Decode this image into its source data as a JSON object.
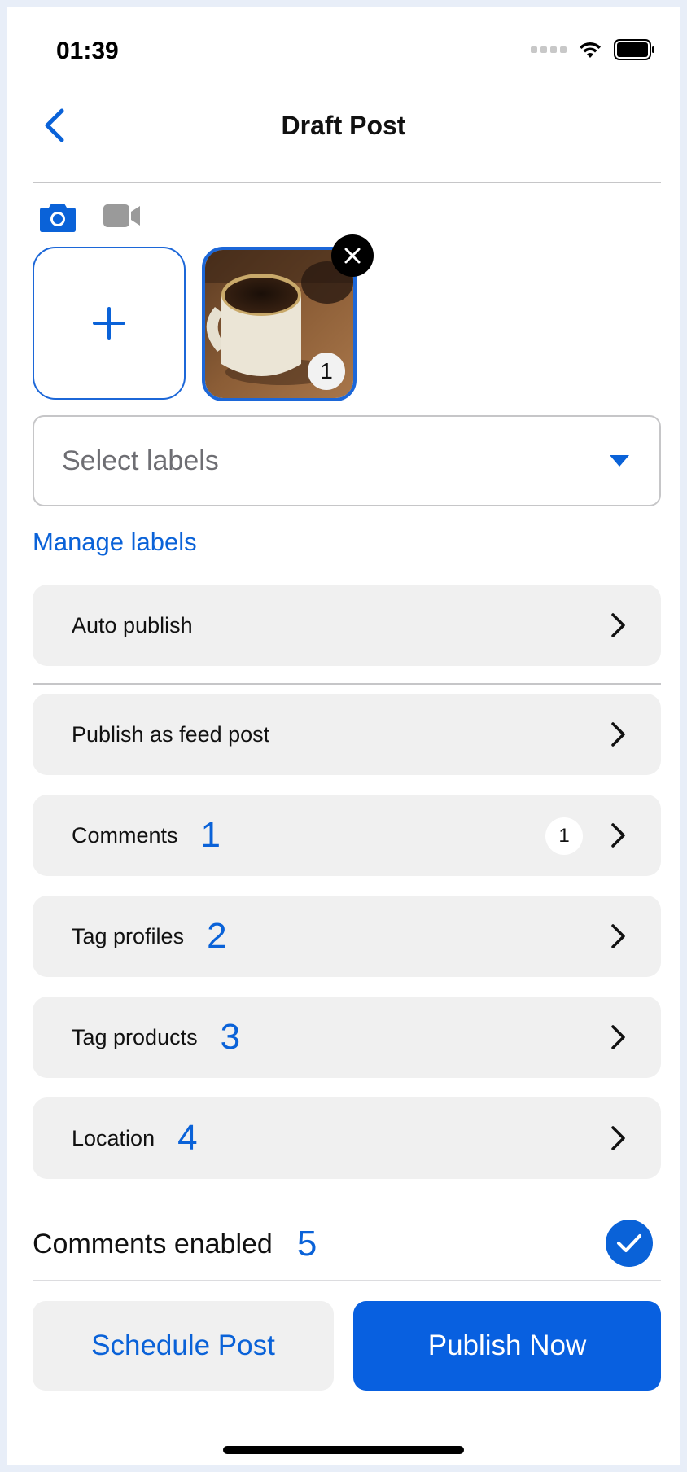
{
  "status_bar": {
    "time": "01:39"
  },
  "header": {
    "title": "Draft Post"
  },
  "media": {
    "tabs": [
      {
        "icon": "camera-icon",
        "active": true
      },
      {
        "icon": "video-icon",
        "active": false
      }
    ],
    "selected_count": "1"
  },
  "labels": {
    "select_placeholder": "Select labels",
    "manage_link": "Manage labels"
  },
  "rows": {
    "auto_publish": {
      "label": "Auto publish"
    },
    "feed_post": {
      "label": "Publish as feed post"
    },
    "comments": {
      "label": "Comments",
      "marker": "1",
      "count": "1"
    },
    "tag_profiles": {
      "label": "Tag profiles",
      "marker": "2"
    },
    "tag_products": {
      "label": "Tag products",
      "marker": "3"
    },
    "location": {
      "label": "Location",
      "marker": "4"
    }
  },
  "comments_enabled": {
    "label": "Comments enabled",
    "marker": "5",
    "checked": true
  },
  "actions": {
    "schedule": "Schedule Post",
    "publish": "Publish Now"
  },
  "colors": {
    "accent": "#0a62d8",
    "primary_button": "#0860e0",
    "row_bg": "#f0f0f0"
  }
}
